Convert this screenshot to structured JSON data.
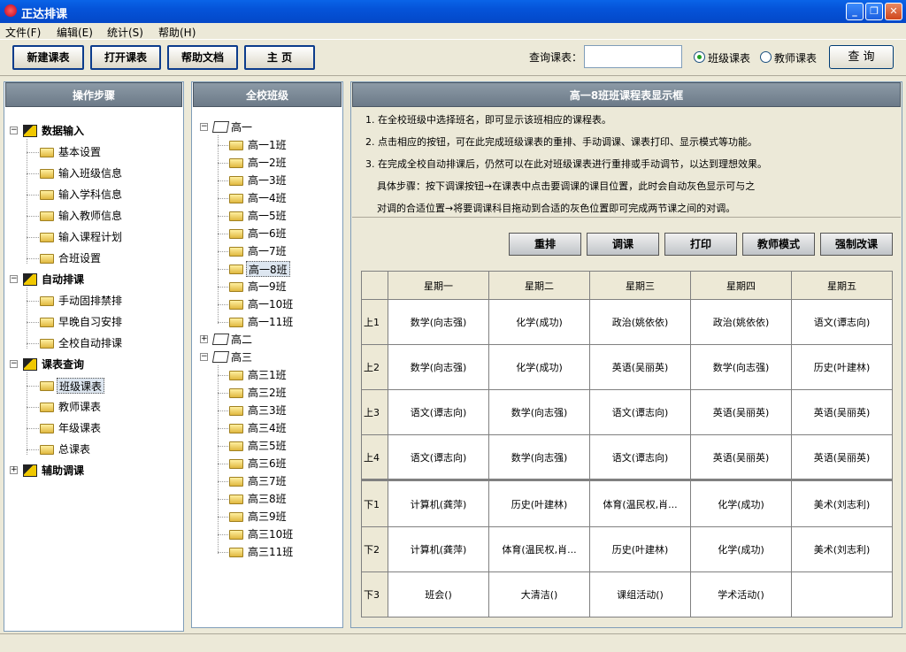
{
  "window": {
    "title": "正达排课",
    "min": "_",
    "max": "❐",
    "close": "✕"
  },
  "menu": [
    "文件(F)",
    "编辑(E)",
    "统计(S)",
    "帮助(H)"
  ],
  "toolbar": {
    "buttons": [
      "新建课表",
      "打开课表",
      "帮助文档",
      "主  页"
    ],
    "query_label": "查询课表：",
    "query_value": "",
    "radio_class": "班级课表",
    "radio_teacher": "教师课表",
    "radio_selected": "班级课表",
    "query_button": "查 询"
  },
  "steps": {
    "header": "操作步骤",
    "groups": [
      {
        "label": "数据输入",
        "items": [
          "基本设置",
          "输入班级信息",
          "输入学科信息",
          "输入教师信息",
          "输入课程计划",
          "合班设置"
        ]
      },
      {
        "label": "自动排课",
        "items": [
          "手动固排禁排",
          "早晚自习安排",
          "全校自动排课"
        ]
      },
      {
        "label": "课表查询",
        "items": [
          "班级课表",
          "教师课表",
          "年级课表",
          "总课表"
        ]
      },
      {
        "label": "辅助调课",
        "items": []
      }
    ],
    "selected": "班级课表"
  },
  "classes": {
    "header": "全校班级",
    "grades": [
      {
        "label": "高一",
        "expanded": true,
        "items": [
          "高一1班",
          "高一2班",
          "高一3班",
          "高一4班",
          "高一5班",
          "高一6班",
          "高一7班",
          "高一8班",
          "高一9班",
          "高一10班",
          "高一11班"
        ]
      },
      {
        "label": "高二",
        "expanded": false,
        "items": []
      },
      {
        "label": "高三",
        "expanded": true,
        "items": [
          "高三1班",
          "高三2班",
          "高三3班",
          "高三4班",
          "高三5班",
          "高三6班",
          "高三7班",
          "高三8班",
          "高三9班",
          "高三10班",
          "高三11班"
        ]
      }
    ],
    "selected": "高一8班"
  },
  "schedule": {
    "header": "高一8班班课程表显示框",
    "instructions": [
      "1. 在全校班级中选择班名，即可显示该班相应的课程表。",
      "2. 点击相应的按钮，可在此完成班级课表的重排、手动调课、课表打印、显示模式等功能。",
      "3. 在完成全校自动排课后，仍然可以在此对班级课表进行重排或手动调节，以达到理想效果。",
      "具体步骤：按下调课按钮→在课表中点击要调课的课目位置，此时会自动灰色显示可与之",
      "对调的合适位置→将要调课科目拖动到合适的灰色位置即可完成两节课之间的对调。"
    ],
    "buttons": [
      "重排",
      "调课",
      "打印",
      "教师模式",
      "强制改课"
    ],
    "days": [
      "星期一",
      "星期二",
      "星期三",
      "星期四",
      "星期五"
    ],
    "rows": [
      {
        "label": "上1",
        "cells": [
          "数学(向志强)",
          "化学(成功)",
          "政治(姚依依)",
          "政治(姚依依)",
          "语文(谭志向)"
        ]
      },
      {
        "label": "上2",
        "cells": [
          "数学(向志强)",
          "化学(成功)",
          "英语(吴丽英)",
          "数学(向志强)",
          "历史(叶建林)"
        ]
      },
      {
        "label": "上3",
        "cells": [
          "语文(谭志向)",
          "数学(向志强)",
          "语文(谭志向)",
          "英语(吴丽英)",
          "英语(吴丽英)"
        ]
      },
      {
        "label": "上4",
        "cells": [
          "语文(谭志向)",
          "数学(向志强)",
          "语文(谭志向)",
          "英语(吴丽英)",
          "英语(吴丽英)"
        ]
      },
      {
        "label": "下1",
        "cells": [
          "计算机(龚萍)",
          "历史(叶建林)",
          "体育(温民权,肖...",
          "化学(成功)",
          "美术(刘志利)"
        ]
      },
      {
        "label": "下2",
        "cells": [
          "计算机(龚萍)",
          "体育(温民权,肖...",
          "历史(叶建林)",
          "化学(成功)",
          "美术(刘志利)"
        ]
      },
      {
        "label": "下3",
        "cells": [
          "班会()",
          "大清洁()",
          "课组活动()",
          "学术活动()",
          ""
        ]
      }
    ]
  }
}
